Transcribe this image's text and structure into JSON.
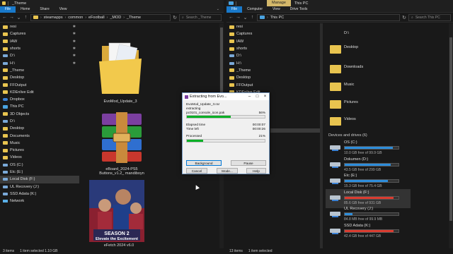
{
  "left_window": {
    "title": "_Theme",
    "ribbon_tabs": [
      "File",
      "Home",
      "Share",
      "View"
    ],
    "breadcrumb": [
      "steamapps",
      "common",
      "eFootball",
      "_MOD",
      "_Theme"
    ],
    "search_placeholder": "Search _Theme",
    "nav_items": [
      {
        "label": "resi",
        "icon": "folder-icon",
        "pinned": true
      },
      {
        "label": "Captures",
        "icon": "folder-icon",
        "pinned": true
      },
      {
        "label": "IAW",
        "icon": "folder-icon",
        "pinned": true
      },
      {
        "label": "shorts",
        "icon": "folder-icon",
        "pinned": true
      },
      {
        "label": "D:\\",
        "icon": "drive-icon",
        "pinned": true
      },
      {
        "label": "H:\\",
        "icon": "drive-icon",
        "pinned": true
      },
      {
        "label": "_Theme",
        "icon": "folder-icon",
        "pinned": false
      },
      {
        "label": "Desktop",
        "icon": "folder-icon",
        "pinned": false
      },
      {
        "label": "FFOutput",
        "icon": "folder-icon",
        "pinned": false
      },
      {
        "label": "KDEnlive Edit",
        "icon": "folder-icon",
        "pinned": false
      },
      {
        "label": "Dropbox",
        "icon": "dropbox-icon",
        "pinned": false
      },
      {
        "label": "This PC",
        "icon": "pc-icon",
        "pinned": false
      },
      {
        "label": "3D Objects",
        "icon": "folder-icon",
        "pinned": false
      },
      {
        "label": "D:\\",
        "icon": "drive-icon",
        "pinned": false
      },
      {
        "label": "Desktop",
        "icon": "folder-icon",
        "pinned": false
      },
      {
        "label": "Documents",
        "icon": "folder-icon",
        "pinned": false
      },
      {
        "label": "Music",
        "icon": "folder-icon",
        "pinned": false
      },
      {
        "label": "Pictures",
        "icon": "folder-icon",
        "pinned": false
      },
      {
        "label": "Videos",
        "icon": "folder-icon",
        "pinned": false
      },
      {
        "label": "OS (C:)",
        "icon": "drive-icon",
        "pinned": false
      },
      {
        "label": "Etc (E:)",
        "icon": "drive-icon",
        "pinned": false
      },
      {
        "label": "Local Disk (F:)",
        "icon": "drive-icon",
        "pinned": false,
        "selected": true
      },
      {
        "label": "UL Recovery (J:)",
        "icon": "drive-icon",
        "pinned": false
      },
      {
        "label": "SSD Adata (K:)",
        "icon": "drive-icon",
        "pinned": false
      },
      {
        "label": "Network",
        "icon": "network-icon",
        "pinned": false
      }
    ],
    "files": [
      {
        "label": "EvoMod_Update_3",
        "kind": "folder"
      },
      {
        "label": "eBoard_2024-PS5 Buttons_v1.2_ mandiboyn",
        "kind": "archive"
      },
      {
        "label": "eFetch 2024 v6.0",
        "kind": "image"
      }
    ],
    "status": {
      "items": "3 items",
      "selected": "1 item selected  1.10 GB"
    }
  },
  "right_window": {
    "title": "This PC",
    "manage_label": "Manage",
    "ribbon_tabs": [
      "File",
      "Computer",
      "View",
      "Drive Tools"
    ],
    "breadcrumb": [
      "This PC"
    ],
    "search_placeholder": "Search This PC",
    "nav_items": [
      {
        "label": "resi",
        "icon": "folder-icon"
      },
      {
        "label": "Captures",
        "icon": "folder-icon"
      },
      {
        "label": "IAW",
        "icon": "folder-icon"
      },
      {
        "label": "shorts",
        "icon": "folder-icon"
      },
      {
        "label": "D:\\",
        "icon": "drive-icon"
      },
      {
        "label": "H:\\",
        "icon": "drive-icon"
      },
      {
        "label": "_Theme",
        "icon": "folder-icon"
      },
      {
        "label": "Desktop",
        "icon": "folder-icon"
      },
      {
        "label": "FFOutput",
        "icon": "folder-icon"
      },
      {
        "label": "KDEnlive Edit",
        "icon": "folder-icon"
      }
    ],
    "folders": [
      "D:\\",
      "Desktop",
      "Downloads",
      "Music",
      "Pictures",
      "Videos"
    ],
    "section_devices": "Devices and drives (6)",
    "drives": [
      {
        "name": "OS (C:)",
        "free": "10.0 GB free of 99.9 GB",
        "used_fraction": 0.9,
        "color": "#2d8ddb"
      },
      {
        "name": "Dokumen (D:)",
        "free": "43.5 GB free of 299 GB",
        "used_fraction": 0.85,
        "color": "#2d8ddb"
      },
      {
        "name": "Etc (E:)",
        "free": "15.3 GB free of 75.4 GB",
        "used_fraction": 0.8,
        "color": "#2d8ddb"
      },
      {
        "name": "Local Disk (F:)",
        "free": "85.6 GB free of 931 GB",
        "used_fraction": 0.91,
        "color": "#da3b2f",
        "selected": true
      },
      {
        "name": "UL Recovery (J:)",
        "free": "84.8 MB free of 99.9 MB",
        "used_fraction": 0.15,
        "color": "#2d8ddb"
      },
      {
        "name": "SSD Adata (K:)",
        "free": "42.4 GB free of 447 GB",
        "used_fraction": 0.91,
        "color": "#da3b2f"
      }
    ],
    "status": {
      "items": "13 items",
      "selected": "1 item selected"
    }
  },
  "dialog": {
    "title": "Extracting from Evo...",
    "archive": "EvoMod_Update_3.rar",
    "action": "extracting",
    "current_file": "pc0101_console_icon.pak",
    "file_percent": "56%",
    "file_progress": 0.56,
    "elapsed_label": "Elapsed time",
    "elapsed_value": "00:00:07",
    "timeleft_label": "Time left",
    "timeleft_value": "00:00:26",
    "processed_label": "Processed",
    "processed_percent": "21%",
    "processed_progress": 0.21,
    "buttons": {
      "background": "Background",
      "pause": "Pause",
      "cancel": "Cancel",
      "mode": "Mode...",
      "help": "Help"
    }
  }
}
